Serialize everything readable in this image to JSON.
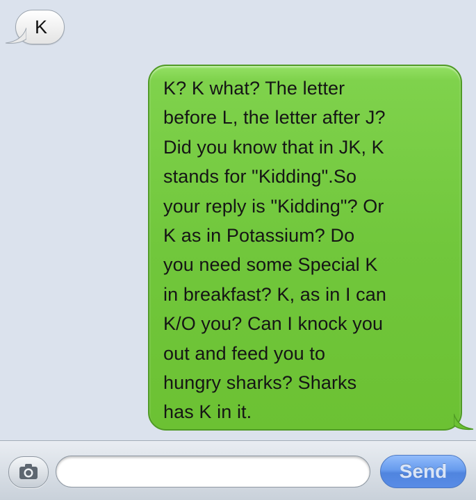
{
  "conversation": {
    "received": {
      "text": "K"
    },
    "sent": {
      "lines": [
        "K? K what? The letter",
        "before L, the letter after J?",
        "Did you know that in JK, K",
        "stands for \"Kidding\".So",
        "your reply is \"Kidding\"? Or",
        "K as in Potassium? Do",
        "you need some Special K",
        "in breakfast? K, as in I can",
        "K/O you? Can I knock you",
        "out and feed you to",
        "hungry sharks? Sharks",
        "has K in it."
      ]
    }
  },
  "composer": {
    "camera_icon": "camera-icon",
    "input_value": "",
    "send_label": "Send"
  },
  "colors": {
    "thread_background": "#dbe2ed",
    "sent_bubble": "#71c73c",
    "received_bubble": "#ffffff",
    "send_button": "#3b7ae8"
  }
}
